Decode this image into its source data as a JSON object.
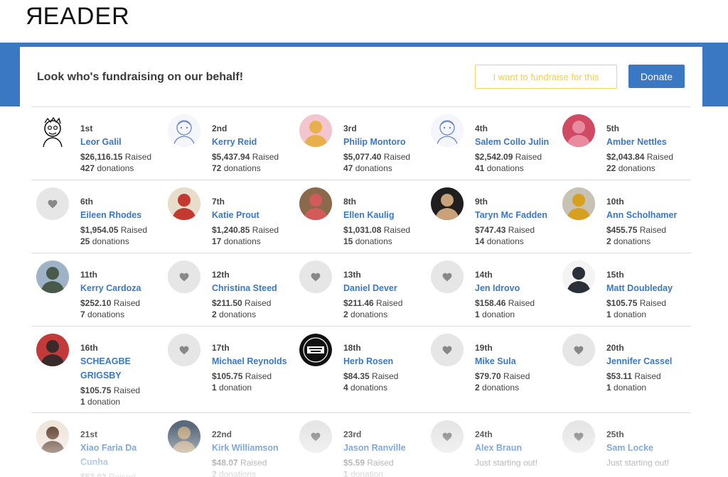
{
  "header": {
    "logo": "READER"
  },
  "panel": {
    "title": "Look who's fundraising on our behalf!",
    "fundraise_label": "I want to fundraise for this",
    "donate_label": "Donate"
  },
  "colors": {
    "accent": "#3a78c3",
    "fundraise_outline": "#f2d66b"
  },
  "raised_suffix": "Raised",
  "rows": [
    [
      {
        "rank": "1st",
        "name": "Leor Galil",
        "amount": "$26,116.15",
        "count": "427",
        "unit": "donations",
        "avatar": "sketch-portrait"
      },
      {
        "rank": "2nd",
        "name": "Kerry Reid",
        "amount": "$5,437.94",
        "count": "72",
        "unit": "donations",
        "avatar": "sketch-portrait"
      },
      {
        "rank": "3rd",
        "name": "Philip Montoro",
        "amount": "$5,077.40",
        "count": "47",
        "unit": "donations",
        "avatar": "photo"
      },
      {
        "rank": "4th",
        "name": "Salem Collo Julin",
        "amount": "$2,542.09",
        "count": "41",
        "unit": "donations",
        "avatar": "sketch-portrait"
      },
      {
        "rank": "5th",
        "name": "Amber Nettles",
        "amount": "$2,043.84",
        "count": "22",
        "unit": "donations",
        "avatar": "photo"
      }
    ],
    [
      {
        "rank": "6th",
        "name": "Eileen Rhodes",
        "amount": "$1,954.05",
        "count": "25",
        "unit": "donations",
        "avatar": "heart-icon"
      },
      {
        "rank": "7th",
        "name": "Katie Prout",
        "amount": "$1,240.85",
        "count": "17",
        "unit": "donations",
        "avatar": "photo"
      },
      {
        "rank": "8th",
        "name": "Ellen Kaulig",
        "amount": "$1,031.08",
        "count": "15",
        "unit": "donations",
        "avatar": "photo"
      },
      {
        "rank": "9th",
        "name": "Taryn Mc Fadden",
        "amount": "$747.43",
        "count": "14",
        "unit": "donations",
        "avatar": "photo"
      },
      {
        "rank": "10th",
        "name": "Ann Scholhamer",
        "amount": "$455.75",
        "count": "2",
        "unit": "donations",
        "avatar": "photo"
      }
    ],
    [
      {
        "rank": "11th",
        "name": "Kerry Cardoza",
        "amount": "$252.10",
        "count": "7",
        "unit": "donations",
        "avatar": "photo"
      },
      {
        "rank": "12th",
        "name": "Christina Steed",
        "amount": "$211.50",
        "count": "2",
        "unit": "donations",
        "avatar": "heart-icon"
      },
      {
        "rank": "13th",
        "name": "Daniel Dever",
        "amount": "$211.46",
        "count": "2",
        "unit": "donations",
        "avatar": "heart-icon"
      },
      {
        "rank": "14th",
        "name": "Jen Idrovo",
        "amount": "$158.46",
        "count": "1",
        "unit": "donation",
        "avatar": "heart-icon"
      },
      {
        "rank": "15th",
        "name": "Matt Doubleday",
        "amount": "$105.75",
        "count": "1",
        "unit": "donation",
        "avatar": "photo"
      }
    ],
    [
      {
        "rank": "16th",
        "name": "SCHEAGBE GRIGSBY",
        "amount": "$105.75",
        "count": "1",
        "unit": "donation",
        "avatar": "photo"
      },
      {
        "rank": "17th",
        "name": "Michael Reynolds",
        "amount": "$105.75",
        "count": "1",
        "unit": "donation",
        "avatar": "heart-icon"
      },
      {
        "rank": "18th",
        "name": "Herb Rosen",
        "amount": "$84.35",
        "count": "4",
        "unit": "donations",
        "avatar": "liars-club-logo"
      },
      {
        "rank": "19th",
        "name": "Mike Sula",
        "amount": "$79.70",
        "count": "2",
        "unit": "donations",
        "avatar": "heart-icon"
      },
      {
        "rank": "20th",
        "name": "Jennifer Cassel",
        "amount": "$53.11",
        "count": "1",
        "unit": "donation",
        "avatar": "heart-icon"
      }
    ],
    [
      {
        "rank": "21st",
        "name": "Xiao Faria Da Cunha",
        "amount": "$53.03",
        "count": "",
        "unit": "",
        "avatar": "photo"
      },
      {
        "rank": "22nd",
        "name": "Kirk Williamson",
        "amount": "$48.07",
        "count": "2",
        "unit": "donations",
        "avatar": "photo"
      },
      {
        "rank": "23rd",
        "name": "Jason Ranville",
        "amount": "$5.59",
        "count": "1",
        "unit": "donation",
        "avatar": "heart-icon"
      },
      {
        "rank": "24th",
        "name": "Alex Braun",
        "status": "Just starting out!",
        "avatar": "heart-icon"
      },
      {
        "rank": "25th",
        "name": "Sam Locke",
        "status": "Just starting out!",
        "avatar": "heart-icon"
      }
    ]
  ],
  "photo_palettes": {
    "3rd": [
      "#f3c6cf",
      "#e8b04a"
    ],
    "5th": [
      "#d04a63",
      "#e88aa0"
    ],
    "7th": [
      "#e8dccb",
      "#c2392f"
    ],
    "8th": [
      "#8a6a4a",
      "#d25a5a"
    ],
    "9th": [
      "#1f1f1f",
      "#c9a27a"
    ],
    "10th": [
      "#c8c2b5",
      "#d8a020"
    ],
    "11th": [
      "#9fb3c8",
      "#4a5a4a"
    ],
    "15th": [
      "#f4f4f4",
      "#2b2f3a"
    ],
    "16th": [
      "#c43a3a",
      "#3b2a2a"
    ],
    "21st": [
      "#efe6dc",
      "#6a4a3a"
    ],
    "22nd": [
      "#5a6a7a",
      "#b8a080"
    ]
  }
}
